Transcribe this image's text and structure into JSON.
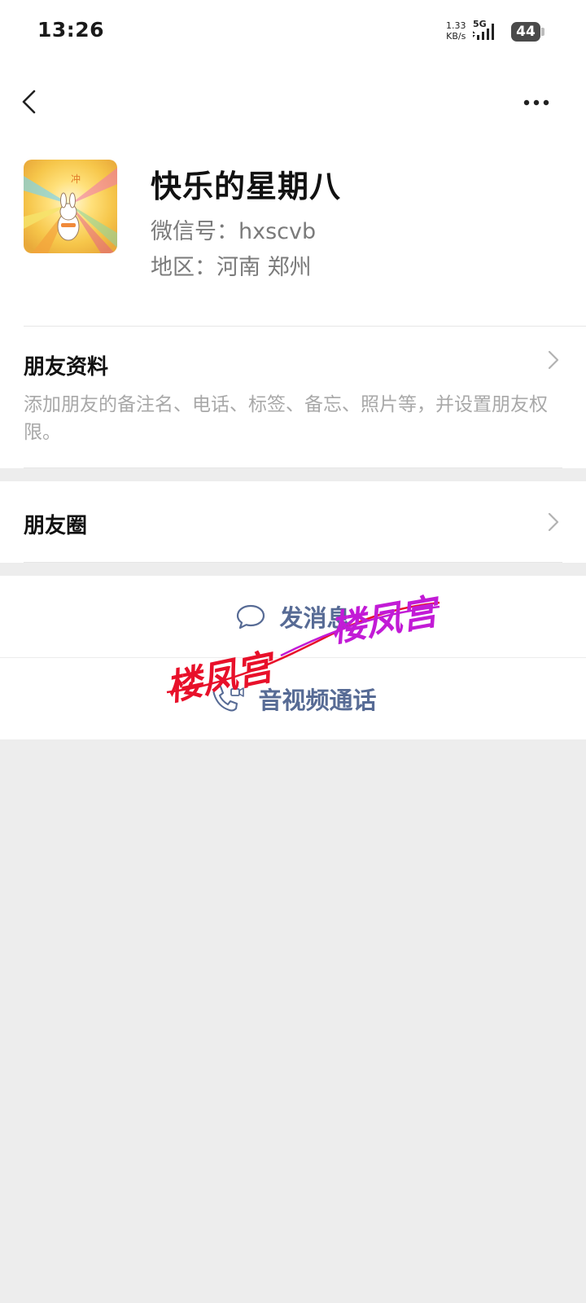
{
  "status_bar": {
    "time": "13:26",
    "net_speed_value": "1.33",
    "net_speed_unit": "KB/s",
    "network": "5G",
    "battery": "44"
  },
  "nav": {
    "back_icon": "chevron-left-icon",
    "more_icon": "more-horizontal-icon"
  },
  "profile": {
    "nickname": "快乐的星期八",
    "wechat_id": "微信号：hxscvb",
    "region": "地区：河南  郑州"
  },
  "friend_info": {
    "title": "朋友资料",
    "description": "添加朋友的备注名、电话、标签、备忘、照片等，并设置朋友权限。"
  },
  "moments": {
    "title": "朋友圈"
  },
  "actions": {
    "message_label": "发消息",
    "call_label": "音视频通话"
  },
  "watermark": {
    "text": "楼凤宫"
  },
  "colors": {
    "link_blue": "#576b95",
    "background_gray": "#ededed",
    "watermark_red": "#e8102a",
    "watermark_magenta": "#c21bd6"
  }
}
